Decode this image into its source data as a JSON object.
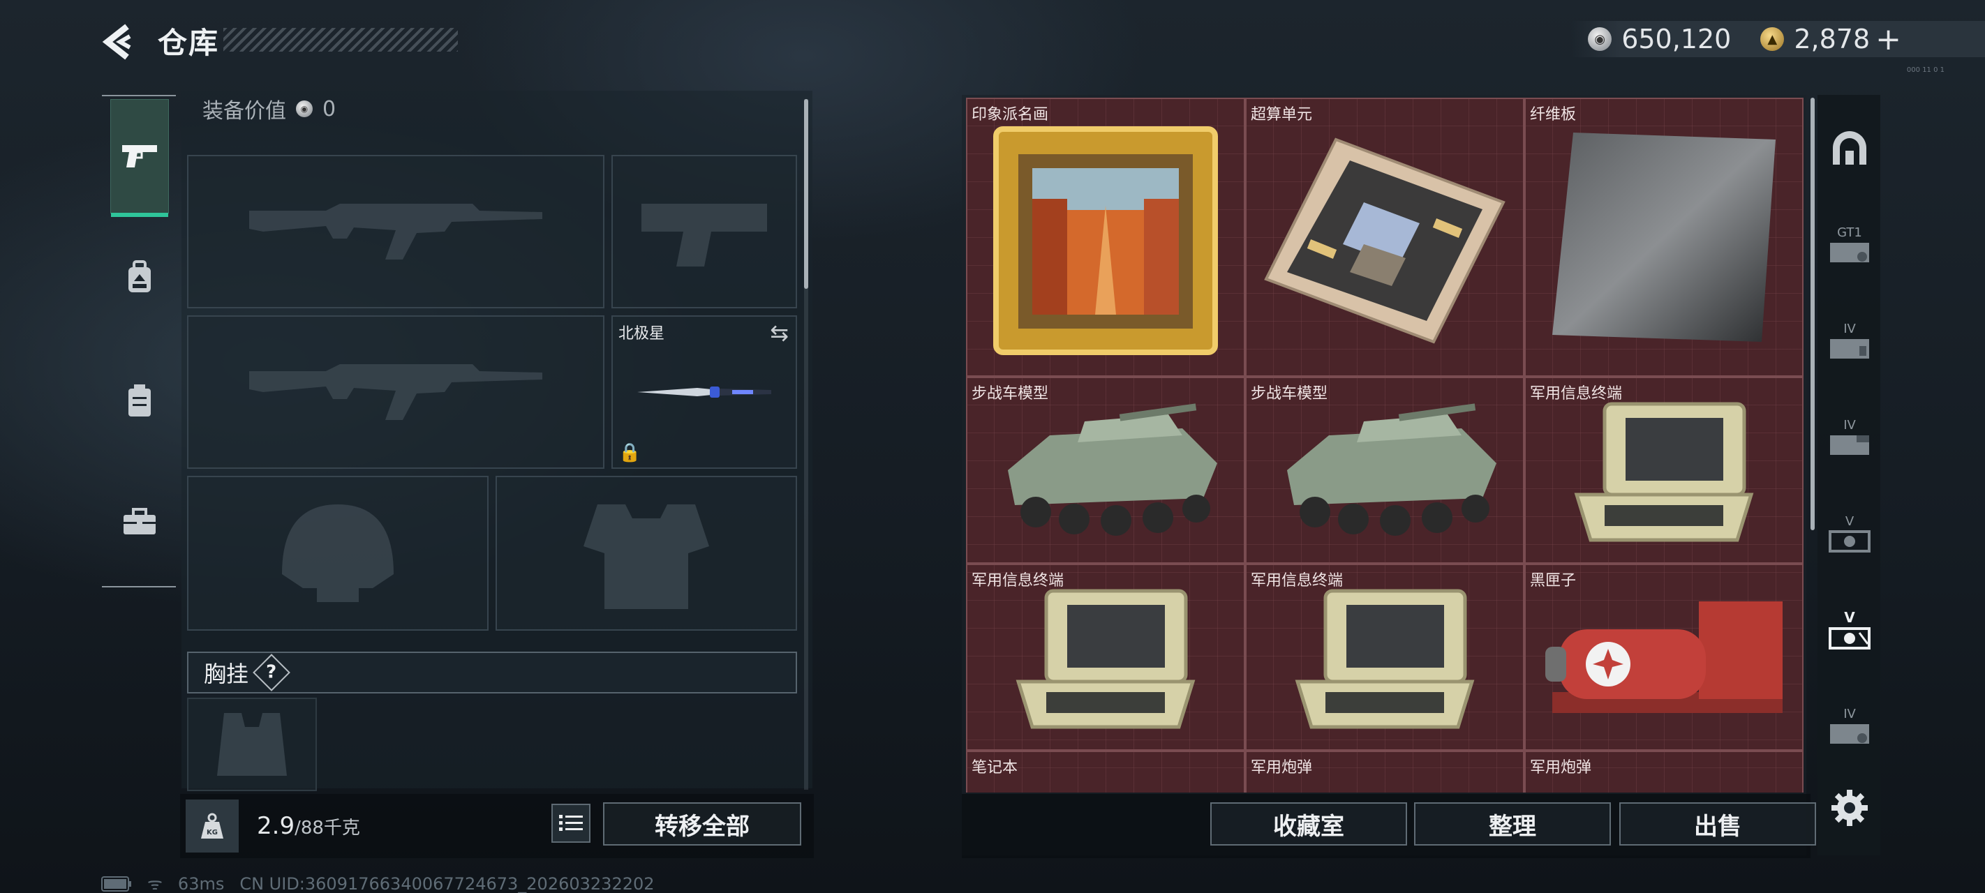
{
  "header": {
    "title": "仓库"
  },
  "currency": {
    "silver": "650,120",
    "gold": "2,878",
    "add": "+"
  },
  "version_tag": "000 11 0 1",
  "sidebar_left": {
    "tabs": [
      {
        "icon": "pistol-icon",
        "active": true
      },
      {
        "icon": "backpack-icon"
      },
      {
        "icon": "vest-icon"
      },
      {
        "icon": "toolbox-icon"
      }
    ]
  },
  "loadout": {
    "equip_value_label": "装备价值",
    "equip_value": "0",
    "melee_slot": {
      "name": "北极星"
    },
    "chest_rig_label": "胸挂",
    "chest_rig_help": "?"
  },
  "weight": {
    "current": "2.9",
    "max": "/88千克",
    "kg_icon_text": "KG"
  },
  "buttons": {
    "transfer_all": "转移全部",
    "collection": "收藏室",
    "organize": "整理",
    "sell": "出售"
  },
  "storage": {
    "items": [
      {
        "label": "印象派名画",
        "icon": "painting-icon"
      },
      {
        "label": "超算单元",
        "icon": "circuit-board-icon"
      },
      {
        "label": "纤维板",
        "icon": "carbon-plate-icon"
      },
      {
        "label": "步战车模型",
        "icon": "ifv-model-icon"
      },
      {
        "label": "步战车模型",
        "icon": "ifv-model-icon"
      },
      {
        "label": "军用信息终端",
        "icon": "field-terminal-icon"
      },
      {
        "label": "军用信息终端",
        "icon": "field-terminal-icon"
      },
      {
        "label": "军用信息终端",
        "icon": "field-terminal-icon"
      },
      {
        "label": "黑匣子",
        "icon": "black-box-icon"
      },
      {
        "label": "笔记本",
        "icon": "laptop-icon"
      },
      {
        "label": "军用炮弹",
        "icon": "shell-icon"
      },
      {
        "label": "军用炮弹",
        "icon": "shell-icon"
      }
    ]
  },
  "sidebar_right": {
    "labels": [
      "GT1",
      "IV",
      "IV",
      "V",
      "V",
      "IV"
    ]
  },
  "status_bar": {
    "ping": "63ms",
    "uid": "CN UID:3609176634006772467​3_202603232202"
  },
  "colors": {
    "storage_bg": "#4a2429",
    "active_tab": "#2fc59a"
  }
}
